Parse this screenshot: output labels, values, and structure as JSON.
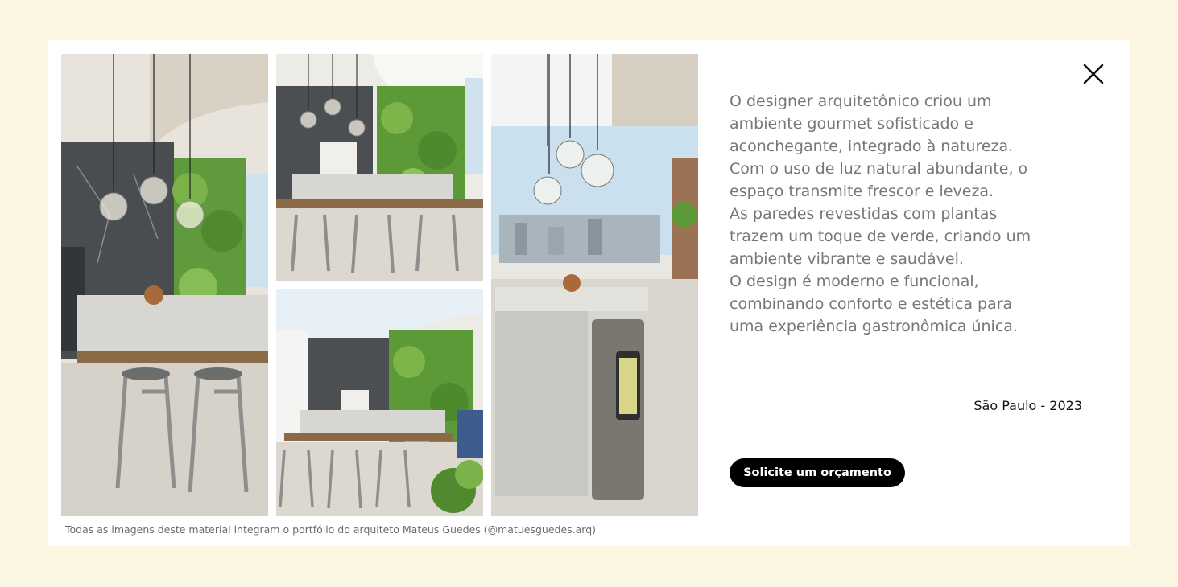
{
  "gallery": {
    "images": [
      {
        "name": "kitchen-island-pendants-photo"
      },
      {
        "name": "dining-table-plant-wall-photo"
      },
      {
        "name": "dining-area-wide-photo"
      },
      {
        "name": "wine-fridge-island-photo"
      }
    ],
    "caption": "Todas as imagens deste material integram o portfólio do arquiteto Mateus Guedes (@matuesguedes.arq)"
  },
  "close_icon": "close-icon",
  "description": {
    "lines": [
      "O designer arquitetônico criou um",
      "ambiente gourmet sofisticado e",
      "aconchegante, integrado à natureza.",
      "Com o uso de luz natural abundante, o",
      "espaço transmite frescor e leveza.",
      "As paredes revestidas com plantas",
      "trazem um toque de verde, criando um",
      "ambiente vibrante e saudável.",
      "O design é moderno e funcional,",
      "combinando conforto e estética para",
      "uma experiência gastronômica única."
    ]
  },
  "location": "São Paulo - 2023",
  "cta_label": "Solicite um orçamento",
  "colors": {
    "page_background": "#fdf6e3",
    "panel_background": "#ffffff",
    "text_gray": "#777777",
    "button_background": "#000000",
    "button_text": "#ffffff"
  }
}
